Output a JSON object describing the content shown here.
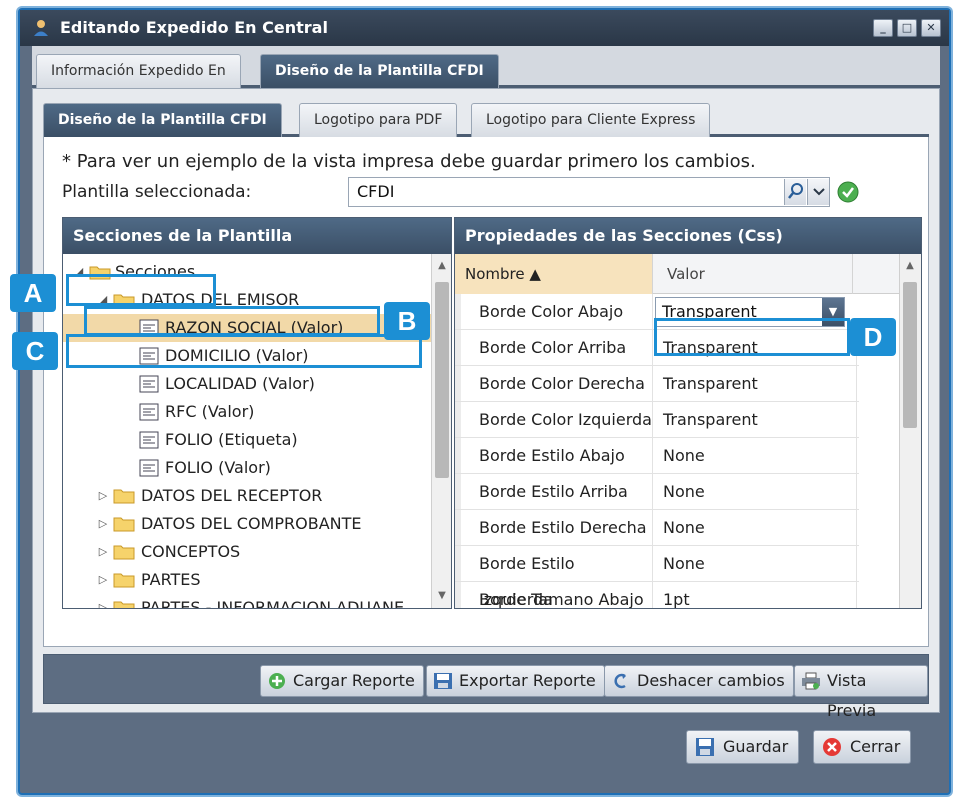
{
  "window": {
    "title": "Editando Expedido En Central",
    "buttons": [
      "minimize",
      "maximize",
      "close"
    ]
  },
  "outer_tabs": [
    {
      "label": "Información Expedido En",
      "active": false
    },
    {
      "label": "Diseño de la Plantilla CFDI",
      "active": true
    }
  ],
  "inner_tabs": [
    {
      "label": "Diseño de la Plantilla CFDI",
      "active": true
    },
    {
      "label": "Logotipo para PDF",
      "active": false
    },
    {
      "label": "Logotipo para Cliente Express",
      "active": false
    }
  ],
  "note": "* Para ver un ejemplo de la vista impresa debe guardar primero los cambios.",
  "template": {
    "label": "Plantilla seleccionada:",
    "value": "CFDI"
  },
  "sections_panel": {
    "title": "Secciones de la Plantilla",
    "tree": [
      {
        "label": "Secciones",
        "kind": "folder",
        "level": 0,
        "expanded": true,
        "selected": false
      },
      {
        "label": "DATOS DEL EMISOR",
        "kind": "folder",
        "level": 1,
        "expanded": true,
        "selected": false
      },
      {
        "label": "RAZON SOCIAL (Valor)",
        "kind": "doc",
        "level": 2,
        "selected": true
      },
      {
        "label": "DOMICILIO (Valor)",
        "kind": "doc",
        "level": 2,
        "selected": false
      },
      {
        "label": "LOCALIDAD (Valor)",
        "kind": "doc",
        "level": 2,
        "selected": false
      },
      {
        "label": "RFC (Valor)",
        "kind": "doc",
        "level": 2,
        "selected": false
      },
      {
        "label": "FOLIO (Etiqueta)",
        "kind": "doc",
        "level": 2,
        "selected": false
      },
      {
        "label": "FOLIO (Valor)",
        "kind": "doc",
        "level": 2,
        "selected": false
      },
      {
        "label": "DATOS DEL RECEPTOR",
        "kind": "folder",
        "level": 1,
        "expanded": false,
        "selected": false
      },
      {
        "label": "DATOS DEL COMPROBANTE",
        "kind": "folder",
        "level": 1,
        "expanded": false,
        "selected": false
      },
      {
        "label": "CONCEPTOS",
        "kind": "folder",
        "level": 1,
        "expanded": false,
        "selected": false
      },
      {
        "label": "PARTES",
        "kind": "folder",
        "level": 1,
        "expanded": false,
        "selected": false
      },
      {
        "label": "PARTES - INFORMACION ADUANE",
        "kind": "folder",
        "level": 1,
        "expanded": false,
        "selected": false
      }
    ]
  },
  "props_panel": {
    "title": "Propiedades de las Secciones (Css)",
    "col_name": "Nombre ▲",
    "col_value": "Valor",
    "rows": [
      {
        "name": "Borde Color Abajo",
        "value": "Transparent",
        "editing": true
      },
      {
        "name": "Borde Color Arriba",
        "value": "Transparent"
      },
      {
        "name": "Borde Color Derecha",
        "value": "Transparent"
      },
      {
        "name": "Borde Color Izquierda",
        "value": "Transparent"
      },
      {
        "name": "Borde Estilo Abajo",
        "value": "None"
      },
      {
        "name": "Borde Estilo Arriba",
        "value": "None"
      },
      {
        "name": "Borde Estilo Derecha",
        "value": "None"
      },
      {
        "name": "Borde Estilo Izquierda",
        "value": "None"
      },
      {
        "name": "Borde Tamano Abajo",
        "value": "1pt"
      }
    ]
  },
  "toolbar": {
    "load": "Cargar Reporte",
    "export": "Exportar Reporte",
    "undo": "Deshacer cambios",
    "preview": "Vista Previa"
  },
  "footer": {
    "save": "Guardar",
    "close": "Cerrar"
  },
  "callouts": [
    "A",
    "B",
    "C",
    "D"
  ],
  "colors": {
    "header_dark": "#3b4f66",
    "selection": "#f2d9a8",
    "callout": "#1c8fd4"
  }
}
